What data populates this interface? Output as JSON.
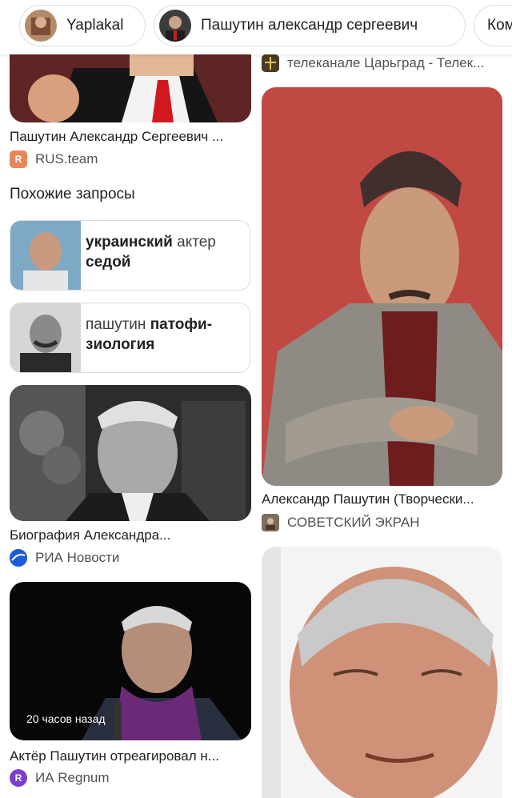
{
  "chips": [
    {
      "label": "Yaplakal"
    },
    {
      "label": "Пашутин александр сергеевич"
    },
    {
      "label": "Ком"
    }
  ],
  "left_col": {
    "card1": {
      "caption": "Пашутин Александр Сергеевич ...",
      "source": "RUS.team"
    },
    "related": {
      "title": "Похожие запросы",
      "items": [
        {
          "bold1": "украинский",
          "normal1": " актер",
          "bold2": "седой",
          "normal2": ""
        },
        {
          "bold1": "",
          "normal1": "пашутин ",
          "bold2": "патофи-",
          "normal2": "",
          "bold3": "зиология"
        }
      ]
    },
    "card2": {
      "caption": "Биография Александра...",
      "source": "РИА Новости"
    },
    "card3": {
      "caption": "Актёр Пашутин отреагировал н...",
      "source": "ИА Regnum",
      "badge": "20 часов назад"
    }
  },
  "right_col": {
    "top_source": "телеканале Царьград - Телек...",
    "card1": {
      "caption": "Александр Пашутин (Творчески...",
      "source": "СОВЕТСКИЙ ЭКРАН"
    }
  },
  "colors": {
    "red_background": "#c8504a",
    "ria_blue": "#1e5bd6",
    "regnum_purple": "#7a3fd0"
  }
}
